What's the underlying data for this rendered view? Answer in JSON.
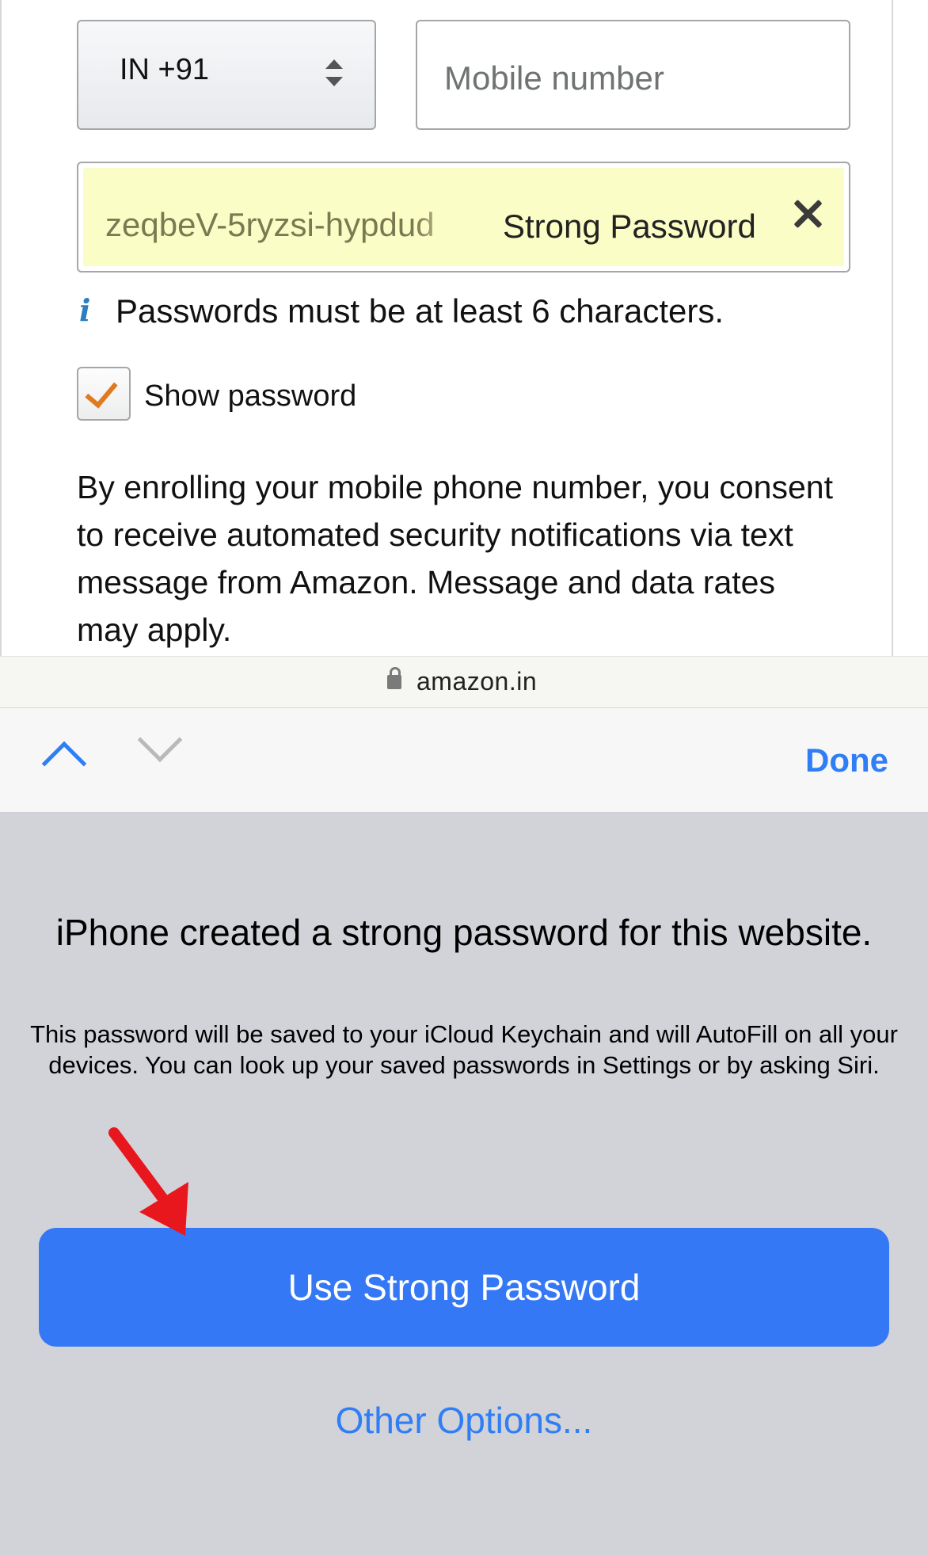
{
  "web_form": {
    "country_code_select": {
      "value": "IN +91"
    },
    "mobile_input": {
      "placeholder": "Mobile number"
    },
    "password_field": {
      "value": "zeqbeV-5ryzsi-hypdud",
      "badge": "Strong Password"
    },
    "password_hint": "Passwords must be at least 6 characters.",
    "show_password": {
      "label": "Show password",
      "checked": true
    },
    "consent_text": "By enrolling your mobile phone number, you consent to receive automated security notifications via text message from Amazon. Message and data rates may apply."
  },
  "address_bar": {
    "domain": "amazon.in"
  },
  "accessory_bar": {
    "done_label": "Done"
  },
  "password_panel": {
    "title": "iPhone created a strong password for this website.",
    "subtitle": "This password will be saved to your iCloud Keychain and will AutoFill on all your devices. You can look up your saved passwords in Settings or by asking Siri.",
    "primary_button": "Use Strong Password",
    "secondary_button": "Other Options..."
  },
  "colors": {
    "accent": "#3478f6",
    "password_fill": "#fafdc5",
    "checkbox_check": "#e07a1f",
    "panel_bg": "#d1d3d9",
    "annotation_arrow": "#e8161d"
  }
}
